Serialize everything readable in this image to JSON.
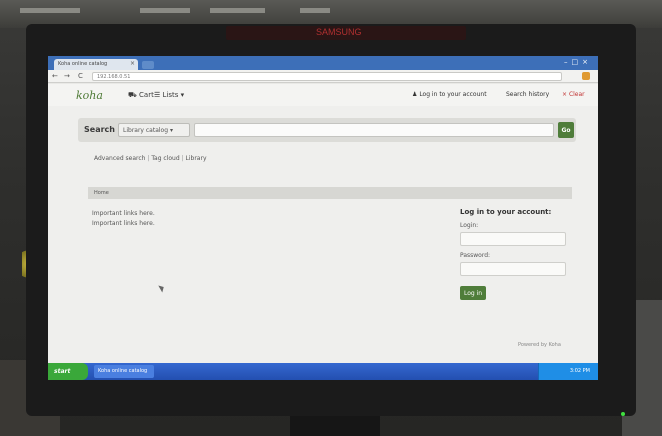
{
  "browser": {
    "tab_title": "Koha online catalog",
    "tab_close": "×",
    "address": "192.168.0.51",
    "nav_back": "←",
    "nav_forward": "→",
    "nav_reload": "C"
  },
  "opac": {
    "logo": "koha",
    "cart": "Cart",
    "lists": "Lists",
    "login_link": "Log in to your account",
    "search_history": "Search history",
    "clear": "Clear",
    "search_label": "Search",
    "search_scope": "Library catalog",
    "search_query": "",
    "go_label": "Go",
    "advanced_search": "Advanced search",
    "tag_cloud": "Tag cloud",
    "libraries": "Library",
    "breadcrumb_home": "Home",
    "links_line1": "Important links here.",
    "links_line2": "Important links here.",
    "login_title": "Log in to your account:",
    "login_label": "Login:",
    "password_label": "Password:",
    "login_button": "Log in",
    "powered_by": "Powered by Koha"
  },
  "taskbar": {
    "start": "start",
    "window_item": "Koha online catalog",
    "clock": "3:02 PM"
  },
  "monitor": {
    "brand": "SAMSUNG"
  },
  "colors": {
    "koha_green": "#4f7d3a",
    "taskbar_blue": "#234fb0",
    "tabbar_blue": "#3d6fb8"
  }
}
